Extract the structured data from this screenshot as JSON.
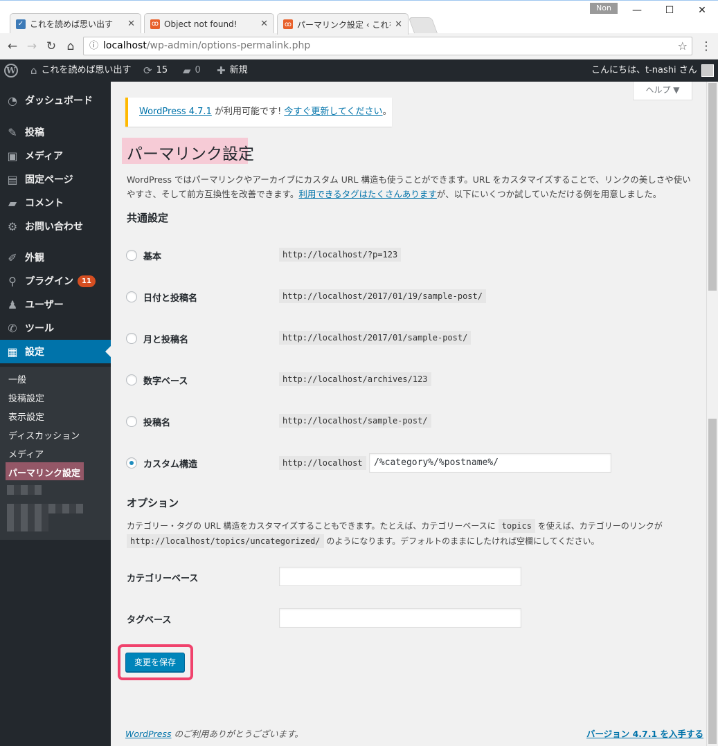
{
  "browser": {
    "tabs": [
      {
        "title": "これを読めば思い出す",
        "icon": "wp-check-favicon"
      },
      {
        "title": "Object not found!",
        "icon": "xampp-favicon"
      },
      {
        "title": "パーマリンク設定 ‹ これを読",
        "icon": "xampp-favicon"
      }
    ],
    "user_badge": "Non",
    "url_host": "localhost",
    "url_path": "/wp-admin/options-permalink.php",
    "window_controls": {
      "minimize": "—",
      "maximize": "☐",
      "close": "✕"
    }
  },
  "adminbar": {
    "site_name": "これを読めば思い出す",
    "updates_count": "15",
    "comments_count": "0",
    "new_label": "新規",
    "greeting": "こんにちは、t-nashi さん"
  },
  "sidebar": {
    "menu": [
      {
        "label": "ダッシュボード",
        "icon": "dashboard-icon"
      },
      {
        "label": "投稿",
        "icon": "pin-icon"
      },
      {
        "label": "メディア",
        "icon": "media-icon"
      },
      {
        "label": "固定ページ",
        "icon": "page-icon"
      },
      {
        "label": "コメント",
        "icon": "comment-icon"
      },
      {
        "label": "お問い合わせ",
        "icon": "gear-icon"
      },
      {
        "label": "外観",
        "icon": "brush-icon"
      },
      {
        "label": "プラグイン",
        "icon": "plugin-icon",
        "badge": "11"
      },
      {
        "label": "ユーザー",
        "icon": "user-icon"
      },
      {
        "label": "ツール",
        "icon": "wrench-icon"
      },
      {
        "label": "設定",
        "icon": "settings-icon"
      }
    ],
    "submenu": [
      "一般",
      "投稿設定",
      "表示設定",
      "ディスカッション",
      "メディア",
      "パーマリンク設定"
    ]
  },
  "content": {
    "help_label": "ヘルプ ▼",
    "notice": {
      "link1": "WordPress 4.7.1",
      "text": " が利用可能です! ",
      "link2": "今すぐ更新してください",
      "end": "。"
    },
    "title": "パーマリンク設定",
    "intro_1": "WordPress ではパーマリンクやアーカイブにカスタム URL 構造も使うことができます。URL をカスタマイズすることで、リンクの美しさや使いやすさ、そして前方互換性を改善できます。",
    "intro_link": "利用できるタグはたくさんあります",
    "intro_2": "が、以下にいくつか試していただける例を用意しました。",
    "common_heading": "共通設定",
    "options": [
      {
        "label": "基本",
        "example": "http://localhost/?p=123",
        "checked": false
      },
      {
        "label": "日付と投稿名",
        "example": "http://localhost/2017/01/19/sample-post/",
        "checked": false
      },
      {
        "label": "月と投稿名",
        "example": "http://localhost/2017/01/sample-post/",
        "checked": false
      },
      {
        "label": "数字ベース",
        "example": "http://localhost/archives/123",
        "checked": false
      },
      {
        "label": "投稿名",
        "example": "http://localhost/sample-post/",
        "checked": false
      },
      {
        "label": "カスタム構造",
        "example": "http://localhost",
        "checked": true
      }
    ],
    "custom_structure_value": "/%category%/%postname%/",
    "option_heading": "オプション",
    "opt_desc_1": "カテゴリー・タグの URL 構造をカスタマイズすることもできます。たとえば、カテゴリーベースに ",
    "opt_code_1": "topics",
    "opt_desc_2": " を使えば、カテゴリーのリンクが",
    "opt_code_2": "http://localhost/topics/uncategorized/",
    "opt_desc_3": " のようになります。デフォルトのままにしたければ空欄にしてください。",
    "category_base_label": "カテゴリーベース",
    "category_base_value": "",
    "tag_base_label": "タグベース",
    "tag_base_value": "",
    "save_label": "変更を保存",
    "footer_link": "WordPress",
    "footer_text": " のご利用ありがとうございます。",
    "footer_version": "バージョン 4.7.1 を入手する"
  },
  "colors": {
    "accent": "#0073aa",
    "adminbar": "#23282d",
    "highlight": "#f0426c"
  }
}
